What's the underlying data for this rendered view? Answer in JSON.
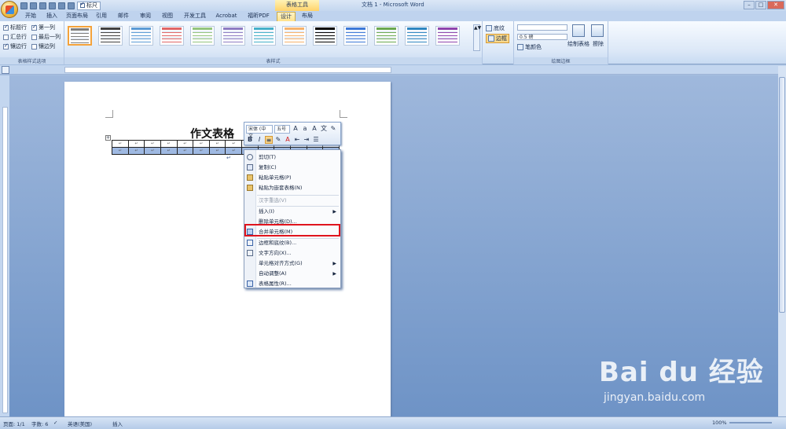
{
  "qat": {
    "ruler_check": "标尺"
  },
  "titlebar": {
    "context_tool": "表格工具",
    "title": "文档 1 - Microsoft Word"
  },
  "tabs": [
    {
      "label": "开始"
    },
    {
      "label": "插入"
    },
    {
      "label": "页面布局"
    },
    {
      "label": "引用"
    },
    {
      "label": "邮件"
    },
    {
      "label": "审阅"
    },
    {
      "label": "视图"
    },
    {
      "label": "开发工具"
    },
    {
      "label": "Acrobat"
    },
    {
      "label": "福昕PDF"
    },
    {
      "label": "设计"
    },
    {
      "label": "布局"
    }
  ],
  "ribbon": {
    "options_group": {
      "label": "表格样式选项",
      "items": [
        {
          "label": "标题行",
          "checked": true
        },
        {
          "label": "第一列",
          "checked": true
        },
        {
          "label": "汇总行",
          "checked": false
        },
        {
          "label": "最后一列",
          "checked": false
        },
        {
          "label": "镶边行",
          "checked": true
        },
        {
          "label": "镶边列",
          "checked": false
        }
      ]
    },
    "styles_group": {
      "label": "表样式"
    },
    "shading_label": "底纹",
    "borders_label": "边框",
    "pen_weight": "0.5 磅",
    "pen_color_label": "笔颜色",
    "draw_table_label": "绘制表格",
    "eraser_label": "擦除",
    "draw_group_label": "绘图边框"
  },
  "document": {
    "title": "作文表格",
    "cell_mark": "↵",
    "para_mark": "↵"
  },
  "mini_toolbar": {
    "font": "宋体 (中文",
    "size": "五号"
  },
  "context_menu": {
    "items": [
      {
        "label": "剪切(T)",
        "icon": "scissors-icon"
      },
      {
        "label": "复制(C)",
        "icon": "copy-icon"
      },
      {
        "label": "粘贴单元格(P)",
        "icon": "paste-icon"
      },
      {
        "label": "粘贴为嵌套表格(N)",
        "icon": "paste-nested-icon"
      },
      {
        "label": "汉字重选(V)",
        "disabled": true
      },
      {
        "label": "插入(I)",
        "submenu": true
      },
      {
        "label": "删除单元格(D)..."
      },
      {
        "label": "合并单元格(M)",
        "icon": "merge-cells-icon",
        "highlighted": true
      },
      {
        "label": "边框和底纹(B)...",
        "icon": "borders-icon"
      },
      {
        "label": "文字方向(X)...",
        "icon": "text-direction-icon"
      },
      {
        "label": "单元格对齐方式(G)",
        "submenu": true
      },
      {
        "label": "自动调整(A)",
        "submenu": true
      },
      {
        "label": "表格属性(R)...",
        "icon": "table-properties-icon"
      }
    ]
  },
  "status": {
    "page": "页面: 1/1",
    "words": "字数: 6",
    "language": "英语(美国)",
    "mode": "插入",
    "zoom": "100%"
  },
  "watermark": {
    "logo": "Bai du 经验",
    "url": "jingyan.baidu.com"
  }
}
